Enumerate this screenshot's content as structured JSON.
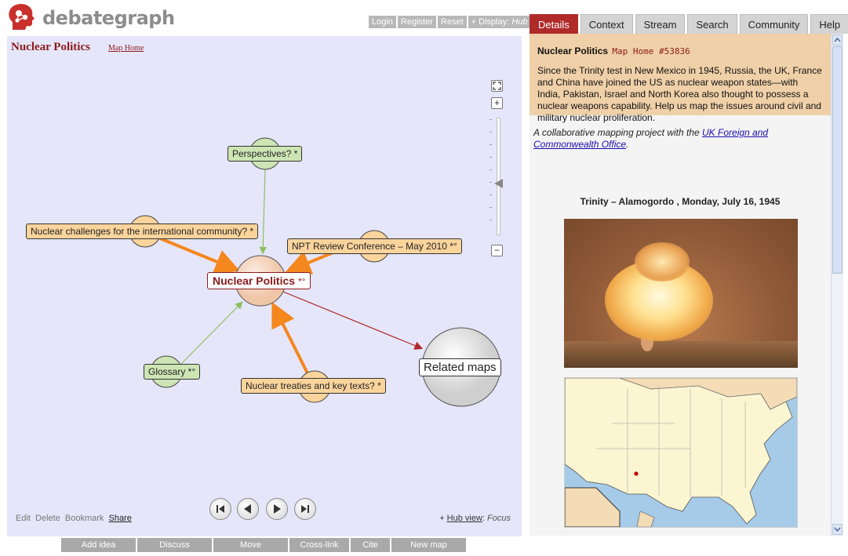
{
  "brand": {
    "name": "debategraph"
  },
  "top_buttons": {
    "login": "Login",
    "register": "Register",
    "reset": "Reset",
    "display_prefix": "+ Display:",
    "display_value": "Hub"
  },
  "map": {
    "title": "Nuclear Politics",
    "home_link": "Map Home",
    "nodes": {
      "perspectives": "Perspectives? *",
      "challenges": "Nuclear challenges for the international community? *",
      "npt": "NPT Review Conference – May 2010 *°",
      "main_title": "Nuclear Politics",
      "main_suffix": "*°",
      "glossary": "Glossary *°",
      "treaties": "Nuclear treaties and key texts? *",
      "related": "Related maps"
    },
    "footer_left": {
      "edit": "Edit",
      "delete": "Delete",
      "bookmark": "Bookmark",
      "share": "Share"
    },
    "footer_right": {
      "plus": "+",
      "hub_view": "Hub view",
      "separator": ":",
      "focus": "Focus"
    }
  },
  "bottom_toolbar": [
    "Add idea",
    "Discuss",
    "Move",
    "Cross-link",
    "Cite",
    "New map"
  ],
  "tabs": [
    "Details",
    "Context",
    "Stream",
    "Search",
    "Community",
    "Help"
  ],
  "active_tab": "Details",
  "details": {
    "title": "Nuclear Politics",
    "subtitle": "Map Home #53836",
    "description": "Since the Trinity test in New Mexico in 1945, Russia, the UK, France and China have joined the US as nuclear weapon states—with India, Pakistan, Israel and North Korea also thought to possess a nuclear weapons capability. Help us map the issues around civil and military nuclear proliferation.",
    "collab_prefix": "A collaborative mapping project with the",
    "collab_link": "UK Foreign and Commonwealth Office",
    "collab_suffix": ".",
    "image_caption": "Trinity – Alamogordo , Monday, July 16, 1945"
  },
  "colors": {
    "accent": "#b02a2a",
    "map_bg": "#e6e6fa",
    "summary_bg": "#f0d0a8",
    "orange_link": "#f5871f",
    "green_link": "#8dbf5f"
  }
}
